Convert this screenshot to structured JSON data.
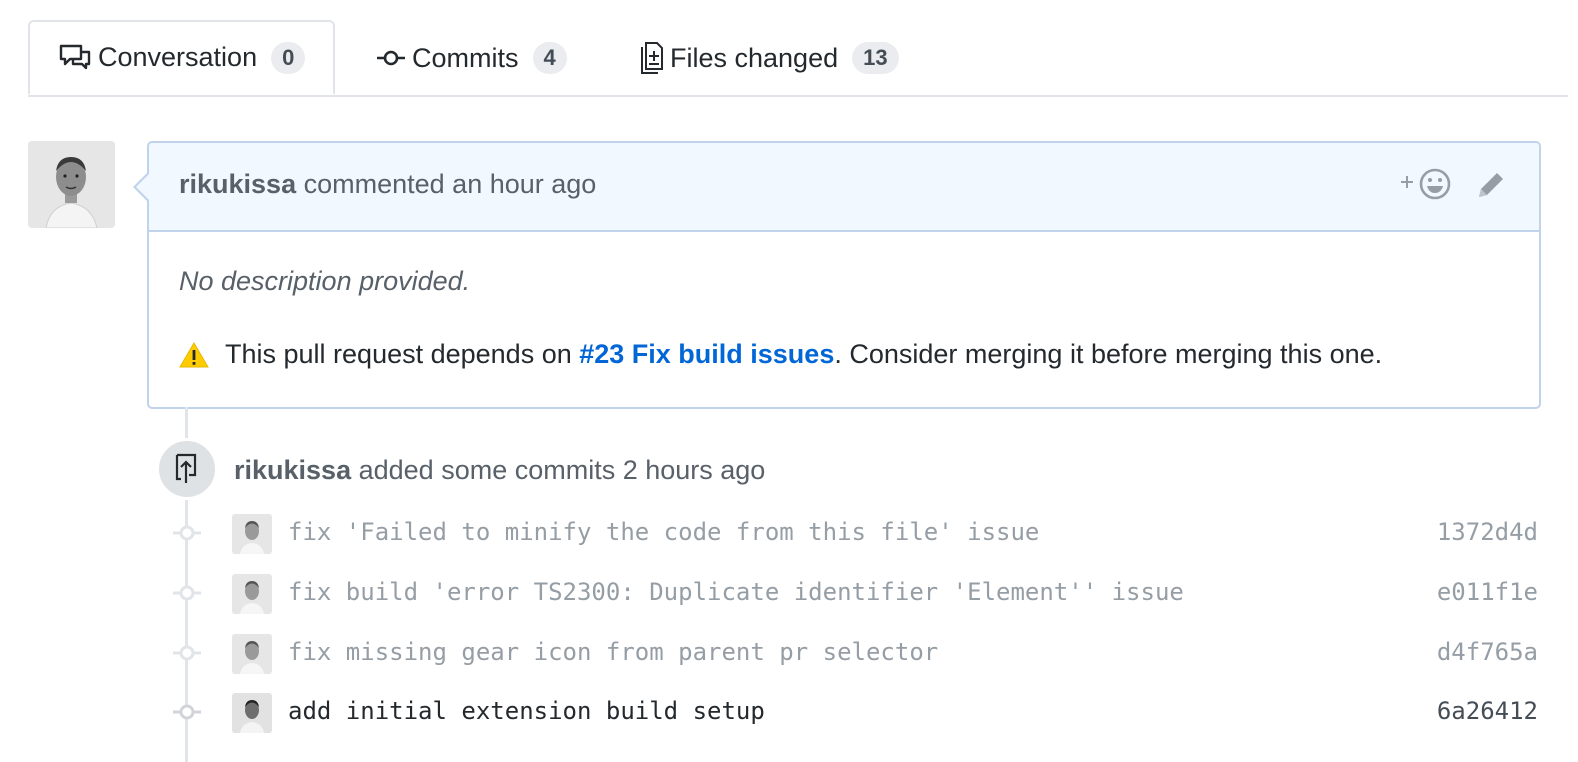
{
  "tabs": [
    {
      "label": "Conversation",
      "count": "0",
      "icon": "comment-discussion-icon",
      "selected": true
    },
    {
      "label": "Commits",
      "count": "4",
      "icon": "git-commit-icon",
      "selected": false
    },
    {
      "label": "Files changed",
      "count": "13",
      "icon": "file-diff-icon",
      "selected": false
    }
  ],
  "comment": {
    "author": "rikukissa",
    "action": "commented an hour ago",
    "body_placeholder": "No description provided.",
    "dependency": {
      "prefix": "This pull request depends on ",
      "link_text": "#23 Fix build issues",
      "suffix": ". Consider merging it before merging this one."
    },
    "reaction_icon": "add-reaction-icon",
    "edit_icon": "pencil-icon",
    "colors": {
      "header_bg": "#f1f8ff",
      "border": "#c0d3eb",
      "link": "#0366d6"
    }
  },
  "event": {
    "author": "rikukissa",
    "action": "added some commits 2 hours ago",
    "icon": "repo-push-icon"
  },
  "commits": [
    {
      "message": "fix 'Failed to minify the code from this file' issue",
      "sha": "1372d4d"
    },
    {
      "message": "fix build 'error TS2300: Duplicate identifier 'Element'' issue",
      "sha": "e011f1e"
    },
    {
      "message": "fix missing gear icon from parent pr selector",
      "sha": "d4f765a"
    },
    {
      "message": "add initial extension build setup",
      "sha": "6a26412"
    }
  ]
}
